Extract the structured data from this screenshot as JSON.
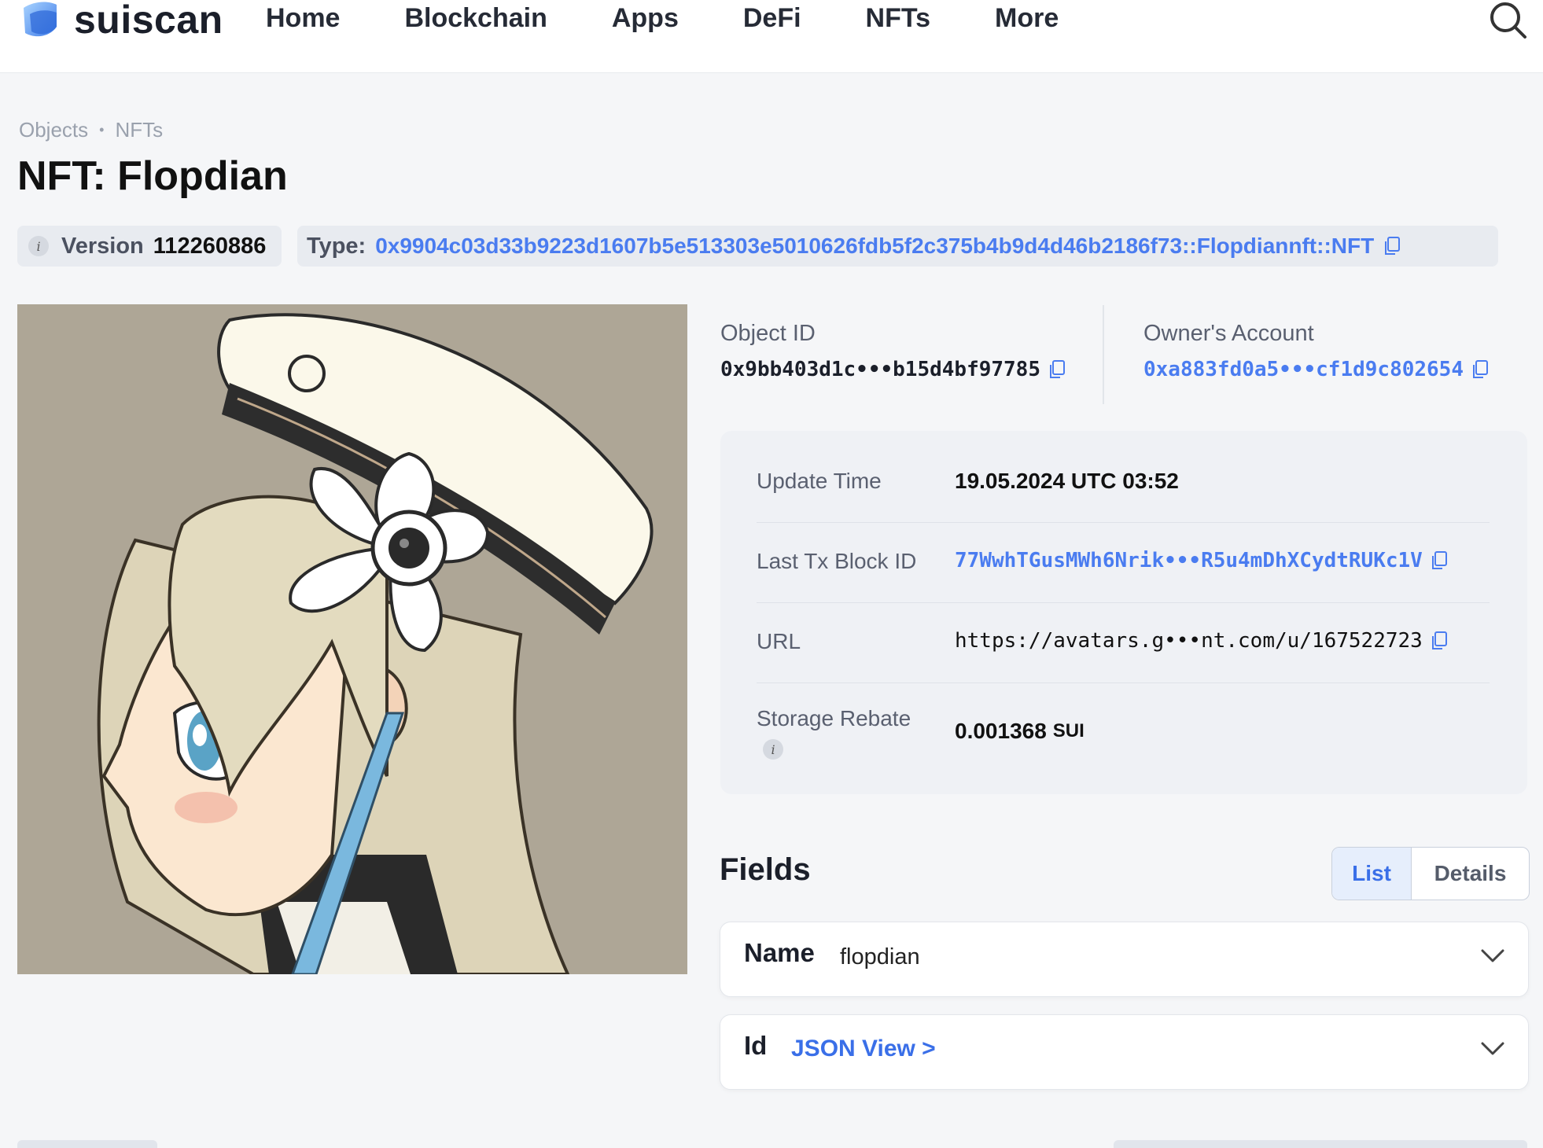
{
  "nav": {
    "brand": "suiscan",
    "items": [
      "Home",
      "Blockchain",
      "Apps",
      "DeFi",
      "NFTs",
      "More"
    ]
  },
  "breadcrumb": [
    "Objects",
    "NFTs"
  ],
  "title": "NFT: Flopdian",
  "version": {
    "label": "Version",
    "value": "112260886"
  },
  "type": {
    "label": "Type:",
    "value": "0x9904c03d33b9223d1607b5e513303e5010626fdb5f2c375b4b9d4d46b2186f73::Flopdiannft::NFT"
  },
  "object_id": {
    "label": "Object ID",
    "value": "0x9bb403d1c•••b15d4bf97785"
  },
  "owner": {
    "label": "Owner's Account",
    "value": "0xa883fd0a5•••cf1d9c802654"
  },
  "details": {
    "update_time": {
      "label": "Update Time",
      "value": "19.05.2024 UTC 03:52"
    },
    "last_tx": {
      "label": "Last Tx Block ID",
      "value": "77WwhTGusMWh6Nrik•••R5u4mDhXCydtRUKc1V"
    },
    "url": {
      "label": "URL",
      "value": "https://avatars.g•••nt.com/u/167522723"
    },
    "storage_rebate": {
      "label": "Storage Rebate",
      "value": "0.001368",
      "unit": "SUI"
    }
  },
  "fields": {
    "title": "Fields",
    "toggle": [
      "List",
      "Details"
    ],
    "rows": [
      {
        "name": "Name",
        "value": "flopdian"
      },
      {
        "name": "Id",
        "link": "JSON View >"
      }
    ]
  },
  "colors": {
    "accent": "#4a7cf0",
    "background": "#f5f6f8",
    "card": "#eff1f5"
  },
  "icons": [
    "suiscan-logo-icon",
    "search-icon",
    "info-icon",
    "copy-icon",
    "chevron-down-icon"
  ]
}
